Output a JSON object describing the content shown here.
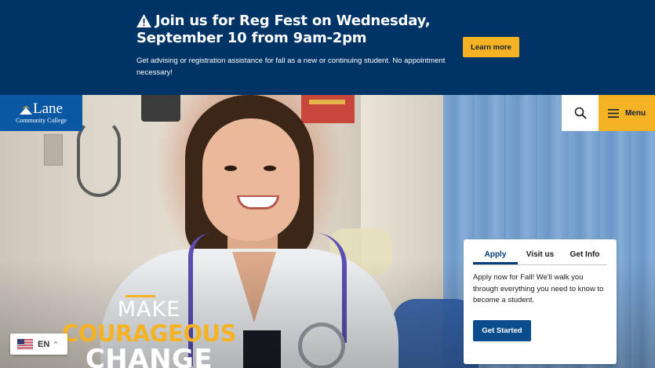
{
  "alert": {
    "title": "Join us for Reg Fest on Wednesday, September 10 from 9am-2pm",
    "description": "Get advising or registration assistance for fall as a new or continuing student. No appointment necessary!",
    "button_label": "Learn more",
    "icon": "warning-icon"
  },
  "header": {
    "logo_name": "Lane",
    "logo_sub": "Community College",
    "search_icon": "search-icon",
    "menu_label": "Menu",
    "menu_icon": "hamburger-icon"
  },
  "hero": {
    "line1": "MAKE",
    "line2": "COURAGEOUS",
    "line3": "CHANGE"
  },
  "card": {
    "tabs": [
      {
        "label": "Apply",
        "active": true
      },
      {
        "label": "Visit us",
        "active": false
      },
      {
        "label": "Get Info",
        "active": false
      }
    ],
    "text": "Apply now for Fall! We'll walk you through everything you need to know to become a student.",
    "button_label": "Get Started"
  },
  "language": {
    "code": "EN",
    "caret": "^",
    "flag_icon": "us-flag-icon"
  },
  "colors": {
    "alert_bg": "#003366",
    "accent": "#f5b324",
    "logo_bg": "#0a57a4",
    "button_blue": "#0a4d8c"
  }
}
